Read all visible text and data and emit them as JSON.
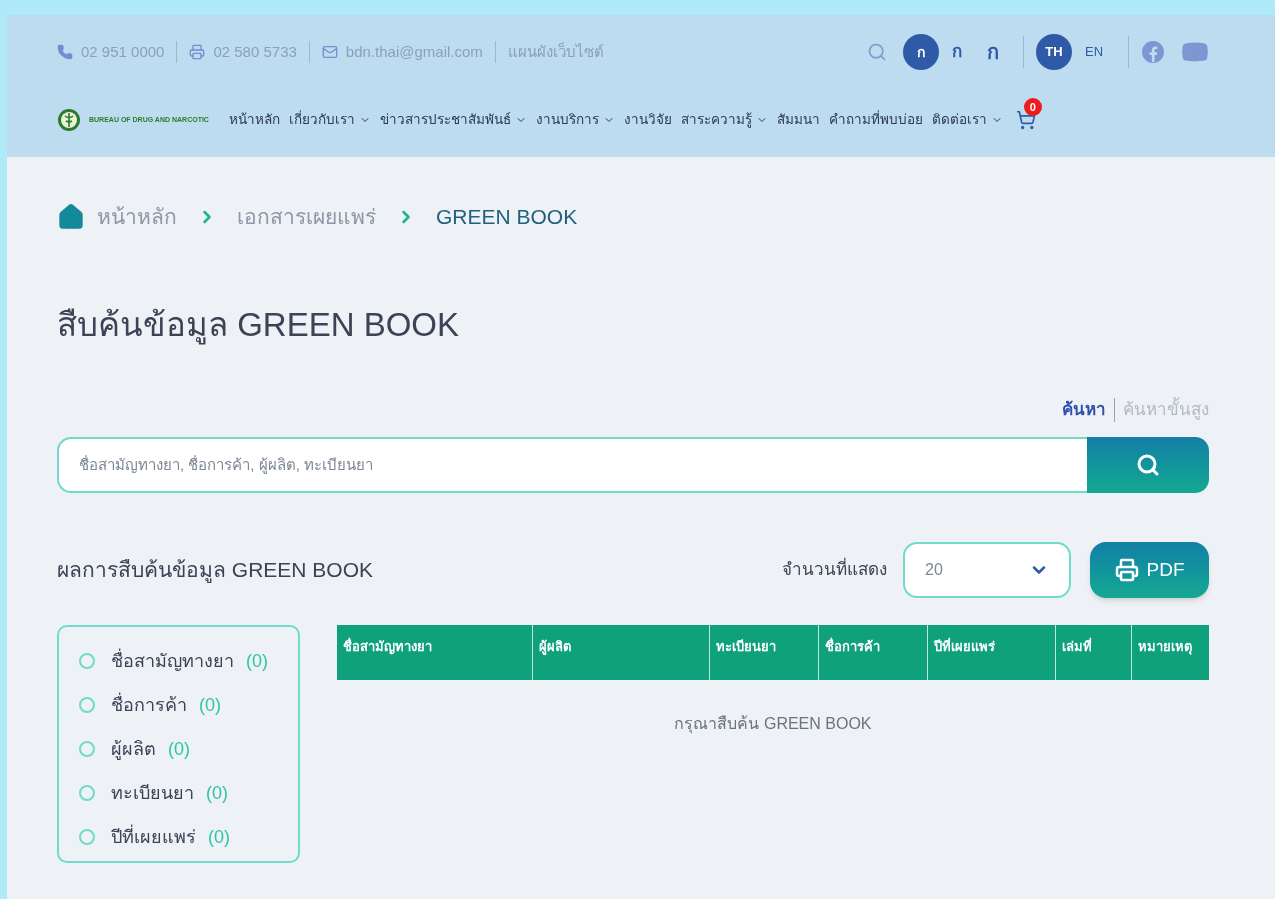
{
  "top_bar": {
    "contacts": [
      {
        "kind": "phone",
        "text": "02 951 0000"
      },
      {
        "kind": "fax",
        "text": "02 580 5733"
      },
      {
        "kind": "email",
        "text": "bdn.thai@gmail.com"
      }
    ],
    "sitemap": "แผนผังเว็บไซต์",
    "font_sizes": [
      {
        "label": "ก",
        "selected": true
      },
      {
        "label": "ก",
        "selected": false
      },
      {
        "label": "ก",
        "selected": false
      }
    ],
    "languages": [
      {
        "label": "TH",
        "selected": true
      },
      {
        "label": "EN",
        "selected": false
      }
    ]
  },
  "nav": {
    "brand": "BUREAU OF DRUG AND NARCOTIC",
    "items": [
      {
        "label": "หน้าหลัก",
        "has_menu": false
      },
      {
        "label": "เกี่ยวกับเรา",
        "has_menu": true
      },
      {
        "label": "ข่าวสารประชาสัมพันธ์",
        "has_menu": true
      },
      {
        "label": "งานบริการ",
        "has_menu": true
      },
      {
        "label": "งานวิจัย",
        "has_menu": false
      },
      {
        "label": "สาระความรู้",
        "has_menu": true
      },
      {
        "label": "สัมมนา",
        "has_menu": false
      },
      {
        "label": "คำถามที่พบบ่อย",
        "has_menu": false
      },
      {
        "label": "ติดต่อเรา",
        "has_menu": true
      }
    ],
    "cart_count": "0"
  },
  "breadcrumb": [
    {
      "label": "หน้าหลัก",
      "selected": false
    },
    {
      "label": "เอกสารเผยแพร่",
      "selected": false
    },
    {
      "label": "GREEN BOOK",
      "selected": true
    }
  ],
  "title": "สืบค้นข้อมูล GREEN BOOK",
  "search_modes": [
    {
      "label": "ค้นหา",
      "selected": true
    },
    {
      "label": "ค้นหาขั้นสูง",
      "selected": false
    }
  ],
  "search": {
    "placeholder": "ชื่อสามัญทางยา, ชื่อการค้า, ผู้ผลิต, ทะเบียนยา"
  },
  "results": {
    "title": "ผลการสืบค้นข้อมูล GREEN BOOK",
    "page_size_label": "จำนวนที่แสดง",
    "page_size": "20",
    "pdf_button": "PDF"
  },
  "filters": [
    {
      "label": "ชื่อสามัญทางยา",
      "count": "(0)",
      "selected": false
    },
    {
      "label": "ชื่อการค้า",
      "count": "(0)",
      "selected": false
    },
    {
      "label": "ผู้ผลิต",
      "count": "(0)",
      "selected": false
    },
    {
      "label": "ทะเบียนยา",
      "count": "(0)",
      "selected": false
    },
    {
      "label": "ปีที่เผยแพร่",
      "count": "(0)",
      "selected": false
    }
  ],
  "table": {
    "columns": [
      "ชื่อสามัญทางยา",
      "ผู้ผลิต",
      "ทะเบียนยา",
      "ชื่อการค้า",
      "ปีที่เผยแพร่",
      "เล่มที่",
      "หมายเหตุ"
    ],
    "empty_message": "กรุณาสืบค้น GREEN BOOK"
  }
}
